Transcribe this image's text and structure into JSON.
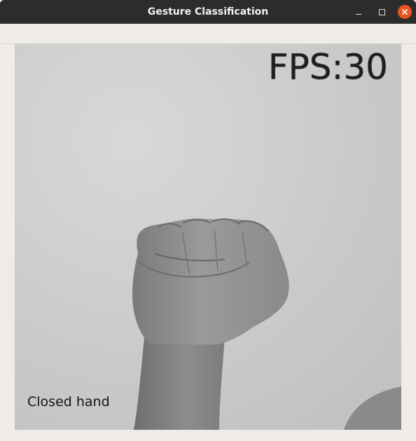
{
  "window": {
    "title": "Gesture Classification",
    "controls": [
      "minimize-icon",
      "maximize-icon",
      "close-icon"
    ],
    "close_color": "#e95420"
  },
  "video": {
    "fps_text": "FPS:30",
    "prediction_label": "Closed hand",
    "subject": "fist"
  }
}
